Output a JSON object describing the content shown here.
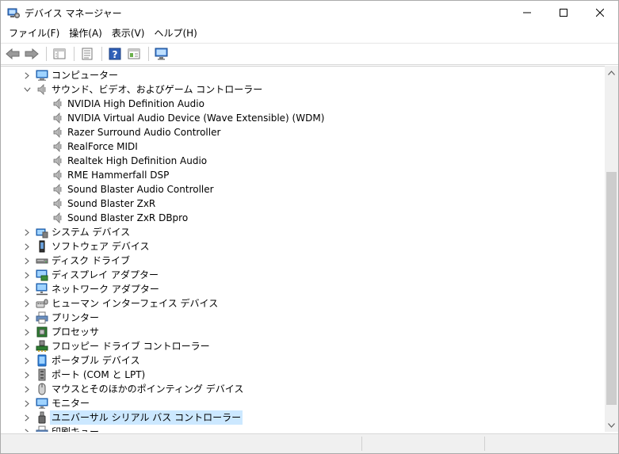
{
  "window": {
    "title": "デバイス マネージャー"
  },
  "menu": [
    "ファイル(F)",
    "操作(A)",
    "表示(V)",
    "ヘルプ(H)"
  ],
  "toolbar": {
    "buttons": [
      "back-icon",
      "forward-icon",
      "properties-view-icon",
      "device-list-icon",
      "help-icon",
      "console-tree-icon",
      "monitor-scan-icon"
    ]
  },
  "tree": {
    "items": [
      {
        "label": "コンピューター",
        "icon": "computer-icon",
        "expanded": false,
        "level": 0
      },
      {
        "label": "サウンド、ビデオ、およびゲーム コントローラー",
        "icon": "speaker-icon",
        "expanded": true,
        "level": 0
      },
      {
        "label": "NVIDIA High Definition Audio",
        "icon": "speaker-icon",
        "level": 1
      },
      {
        "label": "NVIDIA Virtual Audio Device (Wave Extensible) (WDM)",
        "icon": "speaker-icon",
        "level": 1
      },
      {
        "label": "Razer Surround Audio Controller",
        "icon": "speaker-icon",
        "level": 1
      },
      {
        "label": "RealForce MIDI",
        "icon": "speaker-icon",
        "level": 1
      },
      {
        "label": "Realtek High Definition Audio",
        "icon": "speaker-icon",
        "level": 1
      },
      {
        "label": "RME Hammerfall DSP",
        "icon": "speaker-icon",
        "level": 1
      },
      {
        "label": "Sound Blaster Audio Controller",
        "icon": "speaker-icon",
        "level": 1
      },
      {
        "label": "Sound Blaster ZxR",
        "icon": "speaker-icon",
        "level": 1
      },
      {
        "label": "Sound Blaster ZxR DBpro",
        "icon": "speaker-icon",
        "level": 1
      },
      {
        "label": "システム デバイス",
        "icon": "system-device-icon",
        "expanded": false,
        "level": 0
      },
      {
        "label": "ソフトウェア デバイス",
        "icon": "software-device-icon",
        "expanded": false,
        "level": 0
      },
      {
        "label": "ディスク ドライブ",
        "icon": "disk-drive-icon",
        "expanded": false,
        "level": 0
      },
      {
        "label": "ディスプレイ アダプター",
        "icon": "display-adapter-icon",
        "expanded": false,
        "level": 0
      },
      {
        "label": "ネットワーク アダプター",
        "icon": "network-adapter-icon",
        "expanded": false,
        "level": 0
      },
      {
        "label": "ヒューマン インターフェイス デバイス",
        "icon": "hid-icon",
        "expanded": false,
        "level": 0
      },
      {
        "label": "プリンター",
        "icon": "printer-icon",
        "expanded": false,
        "level": 0
      },
      {
        "label": "プロセッサ",
        "icon": "processor-icon",
        "expanded": false,
        "level": 0
      },
      {
        "label": "フロッピー ドライブ コントローラー",
        "icon": "floppy-controller-icon",
        "expanded": false,
        "level": 0
      },
      {
        "label": "ポータブル デバイス",
        "icon": "portable-device-icon",
        "expanded": false,
        "level": 0
      },
      {
        "label": "ポート (COM と LPT)",
        "icon": "port-icon",
        "expanded": false,
        "level": 0
      },
      {
        "label": "マウスとそのほかのポインティング デバイス",
        "icon": "mouse-icon",
        "expanded": false,
        "level": 0
      },
      {
        "label": "モニター",
        "icon": "monitor-icon",
        "expanded": false,
        "level": 0
      },
      {
        "label": "ユニバーサル シリアル バス コントローラー",
        "icon": "usb-icon",
        "expanded": false,
        "level": 0,
        "selected": true
      },
      {
        "label": "印刷キュー",
        "icon": "print-queue-icon",
        "expanded": false,
        "level": 0
      }
    ]
  },
  "colors": {
    "selection": "#cce8ff",
    "scrollbar_track": "#f0f0f0",
    "scrollbar_thumb": "#cdcdcd"
  }
}
